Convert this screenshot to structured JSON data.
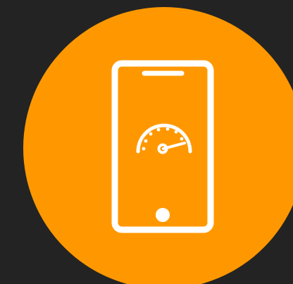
{
  "icon": {
    "name": "mobile-speed-test-icon",
    "parts": [
      "smartphone-outline-icon",
      "speaker-slot-icon",
      "speedometer-icon",
      "home-button-icon"
    ]
  },
  "colors": {
    "background": "#232323",
    "badge": "#FF9800",
    "stroke": "#FFFFFF"
  }
}
